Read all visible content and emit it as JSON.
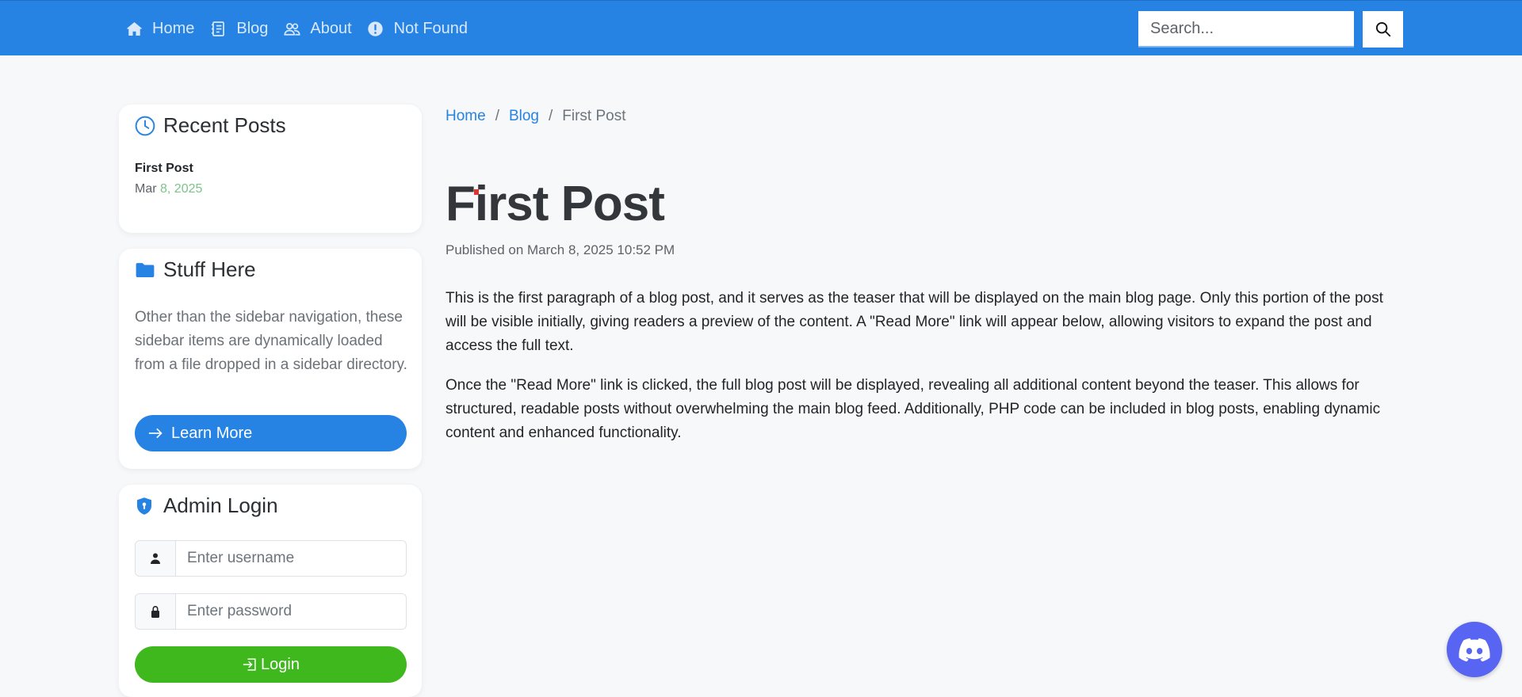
{
  "navbar": {
    "links": [
      {
        "label": "Home",
        "icon": "house-icon"
      },
      {
        "label": "Blog",
        "icon": "journal-icon"
      },
      {
        "label": "About",
        "icon": "people-icon"
      },
      {
        "label": "Not Found",
        "icon": "exclamation-circle-icon"
      }
    ],
    "search": {
      "placeholder": "Search...",
      "button_icon": "search-icon"
    },
    "colors": {
      "background": "#2683e4",
      "link": "#d9e9fb"
    }
  },
  "sidebar": {
    "recent_posts": {
      "title": "Recent Posts",
      "icon": "clock-icon",
      "items": [
        {
          "title": "First Post",
          "date_month": "Mar",
          "date_rest": "8, 2025"
        }
      ]
    },
    "stuff_here": {
      "title": "Stuff Here",
      "icon": "folder-icon",
      "text": "Other than the sidebar navigation, these sidebar items are dynamically loaded from a file dropped in a sidebar directory.",
      "button_label": "Learn More",
      "button_icon": "arrow-right-icon"
    },
    "admin_login": {
      "title": "Admin Login",
      "icon": "shield-lock-icon",
      "username_placeholder": "Enter username",
      "password_placeholder": "Enter password",
      "button_label": "Login",
      "button_icon": "box-arrow-in-icon"
    }
  },
  "main": {
    "breadcrumb": {
      "home": "Home",
      "blog": "Blog",
      "current": "First Post",
      "separator": "/"
    },
    "title": "First Post",
    "meta": "Published on March 8, 2025 10:52 PM",
    "paragraphs": [
      "This is the first paragraph of a blog post, and it serves as the teaser that will be displayed on the main blog page. Only this portion of the post will be visible initially, giving readers a preview of the content. A \"Read More\" link will appear below, allowing visitors to expand the post and access the full text.",
      "Once the \"Read More\" link is clicked, the full blog post will be displayed, revealing all additional content beyond the teaser. This allows for structured, readable posts without overwhelming the main blog feed. Additionally, PHP code can be included in blog posts, enabling dynamic content and enhanced functionality."
    ]
  },
  "discord": {
    "icon": "discord-icon",
    "color": "#5865f2"
  }
}
